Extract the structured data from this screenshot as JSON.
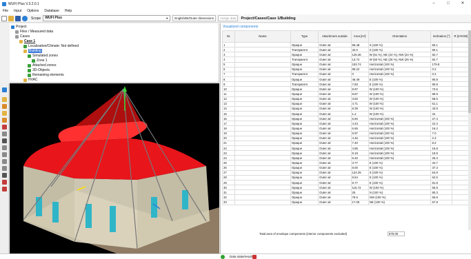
{
  "window": {
    "title": "WUFI Plus V.3.2.0.1",
    "minimize": "–",
    "maximize": "□",
    "close": "✕"
  },
  "menu": [
    "File",
    "Input",
    "Options",
    "Database",
    "Help"
  ],
  "toolbar": {
    "scope_label": "Scope",
    "scope_value": "WUFI Plus",
    "dimension_mode": "English/BI/Outer dimensions",
    "assign_data": "Assign data",
    "breadcrumb": "Project/Cases/Case 1/Building"
  },
  "tree": {
    "project": "Project",
    "files": "Files / Measured data",
    "cases": "Cases",
    "case1": "Case 1",
    "localization": "Localization/Climate: Not defined",
    "building": "Building",
    "simulated_zones": "Simulated zones",
    "zone1": "Zone 1",
    "attached_zones": "Attached zones",
    "objects": "3D-Objects",
    "remaining": "Remaining elements",
    "hvac": "HVAC"
  },
  "panel": {
    "caption": "Visualized components",
    "headers": {
      "no": "Nr.",
      "name": "Name",
      "type": "Type",
      "attachment": "Attachment outside",
      "area": "Area [m²]",
      "orientation": "Orientation",
      "inclination": "Inclination [°]",
      "r": "R [m²K/W]"
    },
    "rows": [
      {
        "no": "1",
        "name": "",
        "type": "Opaque",
        "att": "Outer air",
        "area": "95.48",
        "orient": "S (100 %)",
        "incl": "80.1"
      },
      {
        "no": "2",
        "name": "",
        "type": "Transparent",
        "att": "Outer air",
        "area": "32.0",
        "orient": "S (100 %)",
        "incl": "80.1"
      },
      {
        "no": "3",
        "name": "",
        "type": "Opaque",
        "att": "Outer air",
        "area": "126.36",
        "orient": "W (51 %), NE (24 %), NW (24 %)",
        "incl": "82.7"
      },
      {
        "no": "4",
        "name": "",
        "type": "Transparent",
        "att": "Outer air",
        "area": "13.72",
        "orient": "W (50 %), NE (25 %), NW (25 %)",
        "incl": "82.7"
      },
      {
        "no": "5",
        "name": "",
        "type": "Opaque",
        "att": "Outer air",
        "area": "153.74",
        "orient": "Horizontal (100 %)",
        "incl": "179.8"
      },
      {
        "no": "6",
        "name": "",
        "type": "Opaque",
        "att": "Outer air",
        "area": "85.22",
        "orient": "Horizontal (100 %)",
        "incl": "0.2"
      },
      {
        "no": "7",
        "name": "",
        "type": "Transparent",
        "att": "Outer air",
        "area": "0",
        "orient": "Horizontal (100 %)",
        "incl": "0.2"
      },
      {
        "no": "8",
        "name": "",
        "type": "Opaque",
        "att": "Outer air",
        "area": "45.49",
        "orient": "E (100 %)",
        "incl": "90.8"
      },
      {
        "no": "9",
        "name": "",
        "type": "Transparent",
        "att": "Outer air",
        "area": "7.83",
        "orient": "E (100 %)",
        "incl": "90.8"
      },
      {
        "no": "10",
        "name": "",
        "type": "Opaque",
        "att": "Outer air",
        "area": "8.97",
        "orient": "W (100 %)",
        "incl": "73.6"
      },
      {
        "no": "11",
        "name": "",
        "type": "Opaque",
        "att": "Outer air",
        "area": "8.87",
        "orient": "W (100 %)",
        "incl": "89.9"
      },
      {
        "no": "12",
        "name": "",
        "type": "Opaque",
        "att": "Outer air",
        "area": "3.82",
        "orient": "W (100 %)",
        "incl": "58.5"
      },
      {
        "no": "13",
        "name": "",
        "type": "Opaque",
        "att": "Outer air",
        "area": "4.71",
        "orient": "W (100 %)",
        "incl": "61.1"
      },
      {
        "no": "14",
        "name": "",
        "type": "Opaque",
        "att": "Outer air",
        "area": "8.39",
        "orient": "W (100 %)",
        "incl": "43.5"
      },
      {
        "no": "15",
        "name": "",
        "type": "Opaque",
        "att": "Outer air",
        "area": "1.2",
        "orient": "W (100 %)",
        "incl": "34"
      },
      {
        "no": "16",
        "name": "",
        "type": "Opaque",
        "att": "Outer air",
        "area": "5.60",
        "orient": "Horizontal (100 %)",
        "incl": "27.4"
      },
      {
        "no": "17",
        "name": "",
        "type": "Opaque",
        "att": "Outer air",
        "area": "4.43",
        "orient": "Horizontal (100 %)",
        "incl": "22.3"
      },
      {
        "no": "18",
        "name": "",
        "type": "Opaque",
        "att": "Outer air",
        "area": "6.65",
        "orient": "Horizontal (100 %)",
        "incl": "16.2"
      },
      {
        "no": "19",
        "name": "",
        "type": "Opaque",
        "att": "Outer air",
        "area": "6.97",
        "orient": "Horizontal (100 %)",
        "incl": "7.0"
      },
      {
        "no": "20",
        "name": "",
        "type": "Opaque",
        "att": "Outer air",
        "area": "4.46",
        "orient": "Horizontal (100 %)",
        "incl": "2.3"
      },
      {
        "no": "21",
        "name": "",
        "type": "Opaque",
        "att": "Outer air",
        "area": "7.40",
        "orient": "Horizontal (100 %)",
        "incl": "8.2"
      },
      {
        "no": "22",
        "name": "",
        "type": "Opaque",
        "att": "Outer air",
        "area": "4.85",
        "orient": "Horizontal (100 %)",
        "incl": "16.8"
      },
      {
        "no": "23",
        "name": "",
        "type": "Opaque",
        "att": "Outer air",
        "area": "8.19",
        "orient": "Horizontal (100 %)",
        "incl": "18.9"
      },
      {
        "no": "24",
        "name": "",
        "type": "Opaque",
        "att": "Outer air",
        "area": "9.46",
        "orient": "Horizontal (100 %)",
        "incl": "25.3"
      },
      {
        "no": "25",
        "name": "",
        "type": "Opaque",
        "att": "Outer air",
        "area": "3.77",
        "orient": "E (100 %)",
        "incl": "34.7"
      },
      {
        "no": "26",
        "name": "",
        "type": "Opaque",
        "att": "Outer air",
        "area": "8.00",
        "orient": "E (100 %)",
        "incl": "37.3"
      },
      {
        "no": "27",
        "name": "",
        "type": "Opaque",
        "att": "Outer air",
        "area": "124.25",
        "orient": "S (100 %)",
        "incl": "54.8"
      },
      {
        "no": "28",
        "name": "",
        "type": "Opaque",
        "att": "Outer air",
        "area": "8.64",
        "orient": "E (100 %)",
        "incl": "62.5"
      },
      {
        "no": "29",
        "name": "",
        "type": "Opaque",
        "att": "Outer air",
        "area": "8.77",
        "orient": "E (100 %)",
        "incl": "81.8"
      },
      {
        "no": "30",
        "name": "",
        "type": "Opaque",
        "att": "Outer air",
        "area": "115.72",
        "orient": "W (100 %)",
        "incl": "55.9"
      },
      {
        "no": "31",
        "name": "",
        "type": "Opaque",
        "att": "Outer air",
        "area": "25",
        "orient": "N (100 %)",
        "incl": "80.3"
      },
      {
        "no": "32",
        "name": "",
        "type": "Opaque",
        "att": "Outer air",
        "area": "75.6",
        "orient": "NW (100 %)",
        "incl": "56.8"
      },
      {
        "no": "33",
        "name": "",
        "type": "Opaque",
        "att": "Outer air",
        "area": "17.05",
        "orient": "NE (100 %)",
        "incl": "57.8"
      }
    ],
    "total_label": "Total area of envelope components (interior components excluded)",
    "total_value": "875.05"
  },
  "status": {
    "text": "Data state/results"
  }
}
